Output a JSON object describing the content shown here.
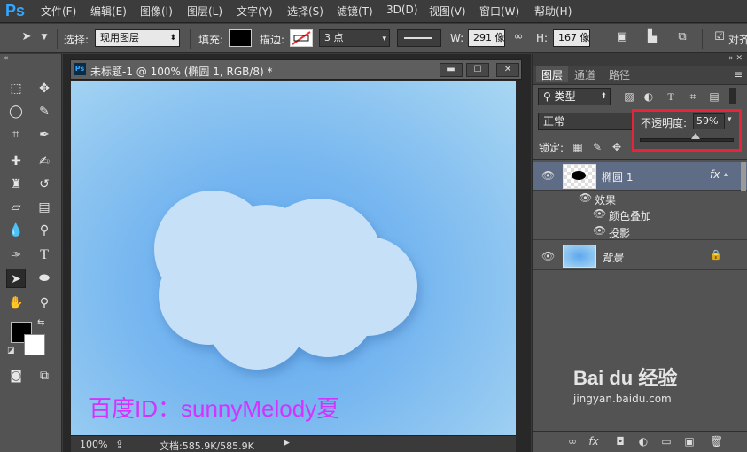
{
  "app": {
    "logo": "Ps"
  },
  "menu": [
    "文件(F)",
    "编辑(E)",
    "图像(I)",
    "图层(L)",
    "文字(Y)",
    "选择(S)",
    "滤镜(T)",
    "3D(D)",
    "视图(V)",
    "窗口(W)",
    "帮助(H)"
  ],
  "options": {
    "select_label": "选择:",
    "select_value": "现用图层",
    "fill_label": "填充:",
    "stroke_label": "描边:",
    "stroke_width": "3 点",
    "width_label": "W:",
    "width_value": "291 像",
    "height_label": "H:",
    "height_value": "167 像",
    "align_label": "对齐"
  },
  "document": {
    "title": "未标题-1 @ 100% (椭圆 1, RGB/8) *",
    "watermark": "百度ID：sunnyMelody夏",
    "zoom": "100%",
    "doc_size": "文档:585.9K/585.9K"
  },
  "layers_panel": {
    "tabs": [
      "图层",
      "通道",
      "路径"
    ],
    "filter_kind": "类型",
    "blend_mode": "正常",
    "opacity_label": "不透明度:",
    "opacity_value": "59%",
    "opacity_fraction": 0.59,
    "lock_label": "锁定:",
    "layers": [
      {
        "name": "椭圆 1",
        "fx": "fx"
      },
      {
        "name": "背景"
      }
    ],
    "effects_label": "效果",
    "effects": [
      "颜色叠加",
      "投影"
    ]
  },
  "watermark_site": "jingyan.baidu.com",
  "watermark_logo": "Bai du 经验",
  "colors": {
    "highlight": "#e8233a",
    "watermark_text": "#d332ff",
    "ps_blue": "#31a8ff"
  }
}
